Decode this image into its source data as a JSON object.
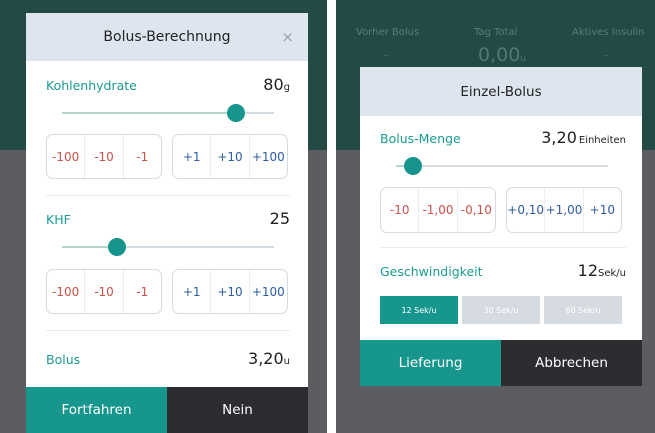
{
  "left": {
    "title": "Bolus-Berechnung",
    "close_symbol": "×",
    "carbs": {
      "label": "Kohlenhydrate",
      "value": "80",
      "unit": "g",
      "slider_fraction": 0.82
    },
    "khf": {
      "label": "KHF",
      "value": "25",
      "slider_fraction": 0.26
    },
    "dec_buttons": [
      "-100",
      "-10",
      "-1"
    ],
    "inc_buttons": [
      "+1",
      "+10",
      "+100"
    ],
    "bolus": {
      "label": "Bolus",
      "value": "3,20",
      "unit": "u"
    },
    "continue_button": "Fortfahren",
    "no_button": "Nein"
  },
  "right": {
    "background": {
      "prev_bolus_label": "Vorher Bolus",
      "prev_bolus_value": "–",
      "day_total_label": "Tag Total",
      "day_total_value": "0,00",
      "day_total_unit": "u",
      "active_insulin_label": "Aktives Insulin",
      "active_insulin_value": "–"
    },
    "title": "Einzel-Bolus",
    "amount": {
      "label": "Bolus-Menge",
      "value": "3,20",
      "unit": "Einheiten",
      "slider_fraction": 0.08
    },
    "dec_buttons": [
      "-10",
      "-1,00",
      "-0,10"
    ],
    "inc_buttons": [
      "+0,10",
      "+1,00",
      "+10"
    ],
    "speed": {
      "label": "Geschwindigkeit",
      "value": "12",
      "unit": "Sek/u"
    },
    "speed_options": [
      "12 Sek/u",
      "30 Sek/u",
      "60 Sek/u"
    ],
    "selected_speed": "12 Sek/u",
    "deliver_button": "Lieferung",
    "cancel_button": "Abbrechen"
  },
  "colors": {
    "accent": "#16968c",
    "header_bg": "#dde6ef",
    "negative": "#c9534b",
    "positive": "#2f5d9e",
    "dark_button": "#2b2d30"
  }
}
